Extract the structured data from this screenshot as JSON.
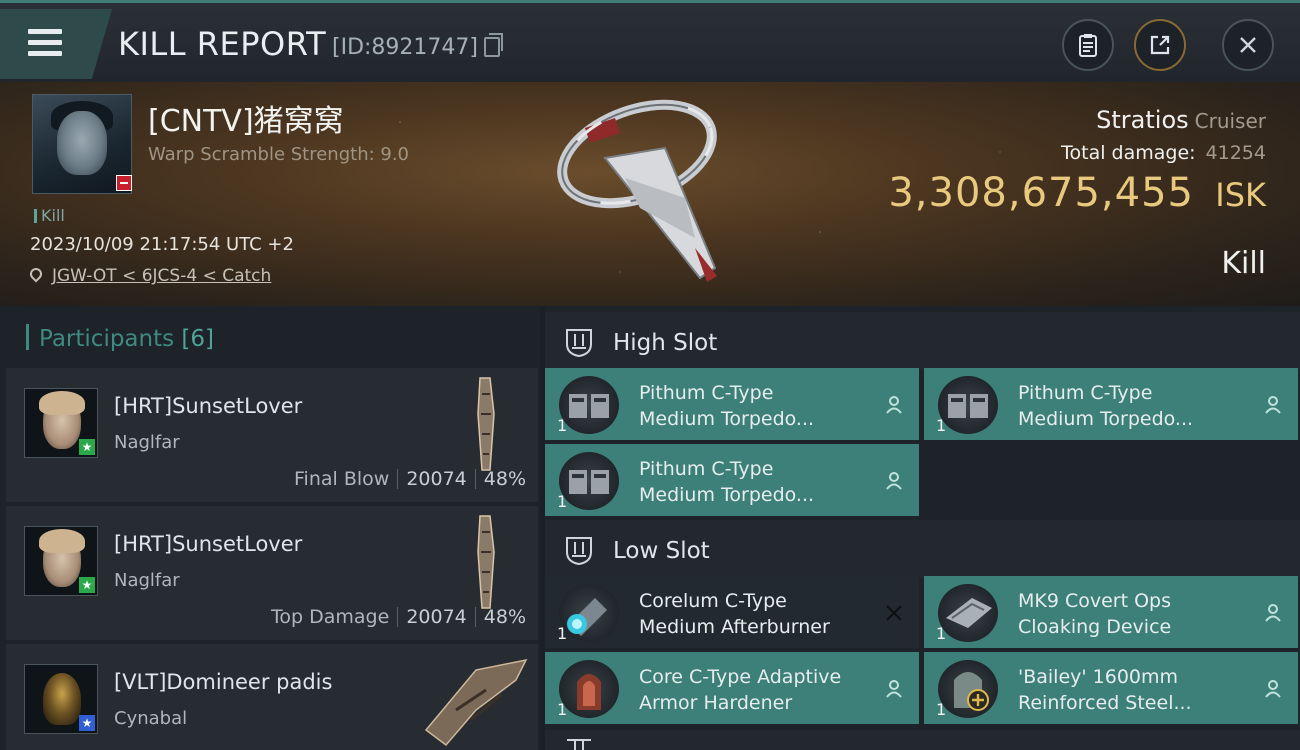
{
  "header": {
    "title": "KILL REPORT",
    "report_id": "[ID:8921747]",
    "icons": [
      "menu-icon",
      "copy-icon",
      "clipboard-icon",
      "share-icon",
      "close-icon"
    ]
  },
  "victim": {
    "name": "[CNTV]猪窝窝",
    "warp_scramble": "Warp Scramble Strength: 9.0",
    "tag": "Kill",
    "timestamp": "2023/10/09 21:17:54 UTC +2",
    "location": "JGW-OT < 6JCS-4 < Catch",
    "ship_name": "Stratios",
    "ship_class": "Cruiser",
    "total_damage_label": "Total damage:",
    "total_damage": "41254",
    "isk_value": "3,308,675,455",
    "isk_unit": "ISK",
    "result": "Kill"
  },
  "participants": {
    "title": "Participants",
    "count": "[6]",
    "items": [
      {
        "name": "[HRT]SunsetLover",
        "ship": "Naglfar",
        "role": "Final Blow",
        "damage": "20074",
        "percent": "48%",
        "badge_color": "#2aa84a"
      },
      {
        "name": "[HRT]SunsetLover",
        "ship": "Naglfar",
        "role": "Top Damage",
        "damage": "20074",
        "percent": "48%",
        "badge_color": "#2aa84a"
      },
      {
        "name": "[VLT]Domineer padis",
        "ship": "Cynabal",
        "badge_color": "#2f5fd0"
      }
    ]
  },
  "fitting": {
    "high_slot": {
      "title": "High Slot",
      "modules": [
        {
          "qty": "1",
          "line1": "Pithum C-Type",
          "line2": "Medium Torpedo...",
          "status": "dropped"
        },
        {
          "qty": "1",
          "line1": "Pithum C-Type",
          "line2": "Medium Torpedo...",
          "status": "dropped"
        },
        {
          "qty": "1",
          "line1": "Pithum C-Type",
          "line2": "Medium Torpedo...",
          "status": "dropped"
        }
      ]
    },
    "low_slot": {
      "title": "Low Slot",
      "modules": [
        {
          "qty": "1",
          "line1": "Corelum C-Type",
          "line2": "Medium Afterburner",
          "status": "destroyed"
        },
        {
          "qty": "1",
          "line1": "MK9 Covert Ops",
          "line2": "Cloaking Device",
          "status": "dropped"
        },
        {
          "qty": "1",
          "line1": "Core C-Type Adaptive",
          "line2": " Armor Hardener",
          "status": "dropped"
        },
        {
          "qty": "1",
          "line1": "'Bailey' 1600mm",
          "line2": "Reinforced Steel...",
          "status": "dropped"
        }
      ]
    }
  },
  "colors": {
    "accent_teal": "#3d7f79",
    "isk_gold": "#e8c97e",
    "destroyed_bg": "#232a2f"
  }
}
